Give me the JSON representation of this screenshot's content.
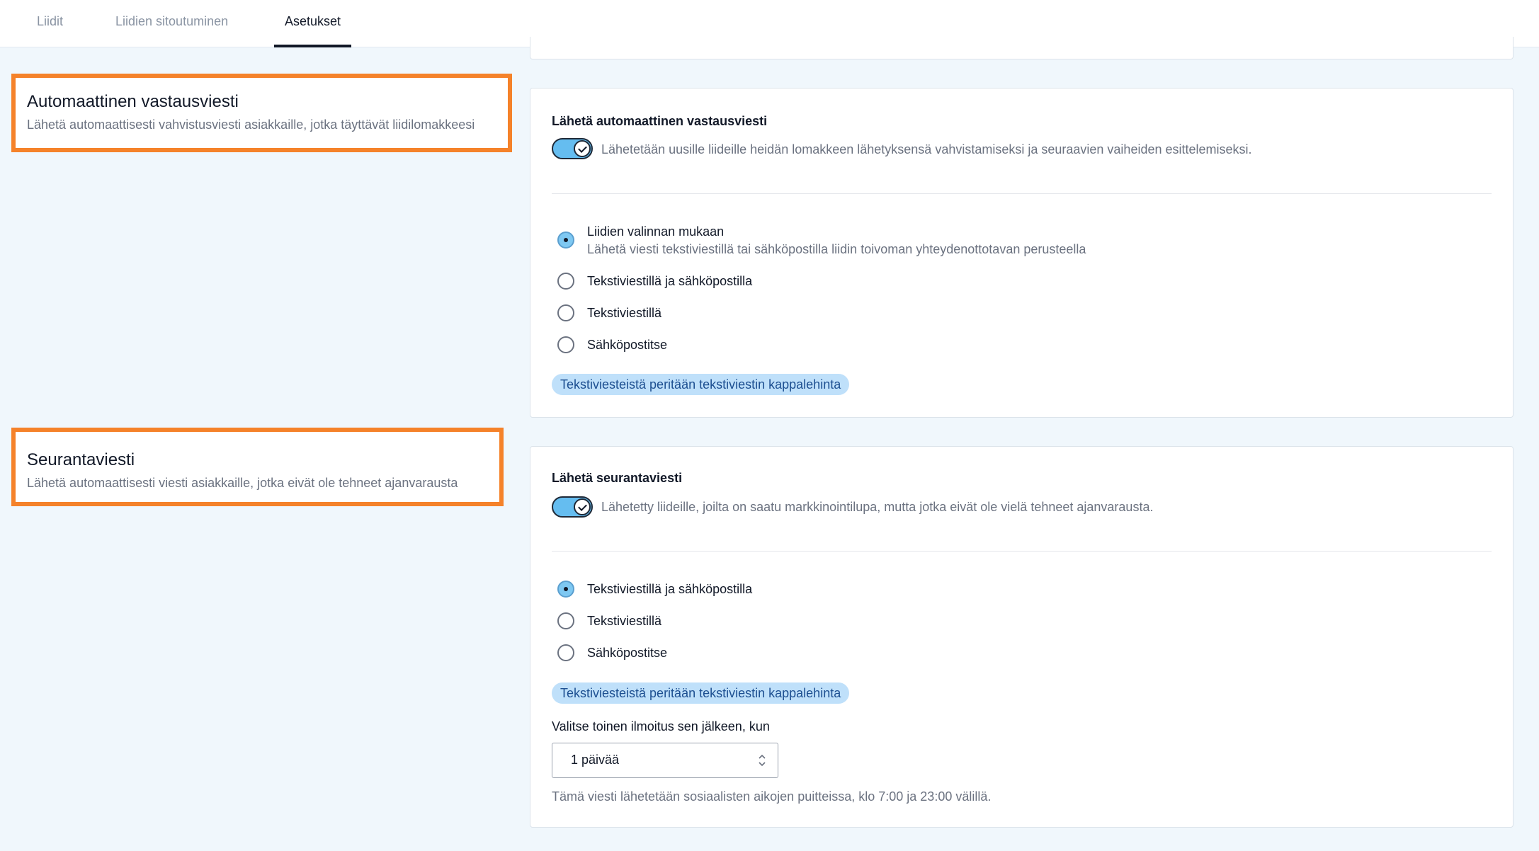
{
  "tabs": [
    {
      "label": "Liidit",
      "active": false
    },
    {
      "label": "Liidien sitoutuminen",
      "active": false
    },
    {
      "label": "Asetukset",
      "active": true
    }
  ],
  "auto_reply": {
    "section_title": "Automaattinen vastausviesti",
    "section_desc": "Lähetä automaattisesti vahvistusviesti asiakkaille, jotka täyttävät liidilomakkeesi",
    "card_title": "Lähetä automaattinen vastausviesti",
    "toggle_on": true,
    "toggle_desc": "Lähetetään uusille liideille heidän lomakkeen lähetyksensä vahvistamiseksi ja seuraavien vaiheiden esittelemiseksi.",
    "options": [
      {
        "label": "Liidien valinnan mukaan",
        "sub": "Lähetä viesti tekstiviestillä tai sähköpostilla liidin toivoman yhteydenottotavan perusteella",
        "checked": true
      },
      {
        "label": "Tekstiviestillä ja sähköpostilla",
        "checked": false
      },
      {
        "label": "Tekstiviestillä",
        "checked": false
      },
      {
        "label": "Sähköpostitse",
        "checked": false
      }
    ],
    "pill": "Tekstiviesteistä peritään tekstiviestin kappalehinta"
  },
  "follow_up": {
    "section_title": "Seurantaviesti",
    "section_desc": "Lähetä automaattisesti viesti asiakkaille, jotka eivät ole tehneet ajanvarausta",
    "card_title": "Lähetä seurantaviesti",
    "toggle_on": true,
    "toggle_desc": "Lähetetty liideille, joilta on saatu markkinointilupa, mutta jotka eivät ole vielä tehneet ajanvarausta.",
    "options": [
      {
        "label": "Tekstiviestillä ja sähköpostilla",
        "checked": true
      },
      {
        "label": "Tekstiviestillä",
        "checked": false
      },
      {
        "label": "Sähköpostitse",
        "checked": false
      }
    ],
    "pill": "Tekstiviesteistä peritään tekstiviestin kappalehinta",
    "select_label": "Valitse toinen ilmoitus sen jälkeen, kun",
    "select_value": "1 päivää",
    "hint": "Tämä viesti lähetetään sosiaalisten aikojen puitteissa, klo 7:00 ja 23:00 välillä."
  },
  "colors": {
    "highlight": "#f5822a",
    "toggle": "#65bdf0",
    "pill_bg": "#bfe0fa",
    "pill_text": "#1d4f91"
  }
}
